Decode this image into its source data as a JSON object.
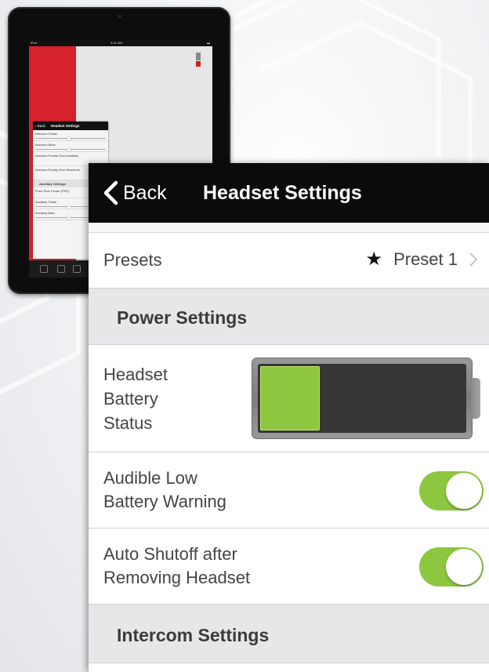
{
  "ipad_preview": {
    "status": {
      "carrier": "iPod",
      "time": "9:41 AM",
      "battery": "▬"
    },
    "header": {
      "back_label": "Back",
      "title": "Headset Settings"
    },
    "rows": [
      {
        "label": "Intercom Treble",
        "kind": "slider"
      },
      {
        "label": "Intercom Bass",
        "kind": "slider"
      },
      {
        "label": "Intercom Priority Over Auxiliary",
        "kind": "text"
      },
      {
        "label": "Intercom Priority Over Bluetooth",
        "kind": "text"
      },
      {
        "label": "Auxiliary Settings",
        "kind": "section"
      },
      {
        "label": "Front Row Center (FRC)",
        "kind": "text"
      },
      {
        "label": "Auxiliary Treble",
        "kind": "slider"
      },
      {
        "label": "Auxiliary Bass",
        "kind": "slider"
      }
    ]
  },
  "nav": {
    "back_label": "Back",
    "title": "Headset Settings"
  },
  "presets": {
    "label": "Presets",
    "value": "Preset 1",
    "star_icon": "★"
  },
  "power_settings": {
    "header": "Power Settings",
    "battery": {
      "label_line1": "Headset",
      "label_line2": "Battery",
      "label_line3": "Status",
      "level": 0.3,
      "fill_color": "#8dc63f"
    },
    "low_battery_warning": {
      "label_line1": "Audible Low",
      "label_line2": "Battery Warning",
      "on": true
    },
    "auto_shutoff": {
      "label_line1": "Auto Shutoff after",
      "label_line2": "Removing Headset",
      "on": true
    }
  },
  "intercom_settings": {
    "header": "Intercom Settings"
  },
  "colors": {
    "accent_green": "#8dc63f",
    "nav_background": "#0b0b0b",
    "brand_red": "#d6222d"
  }
}
